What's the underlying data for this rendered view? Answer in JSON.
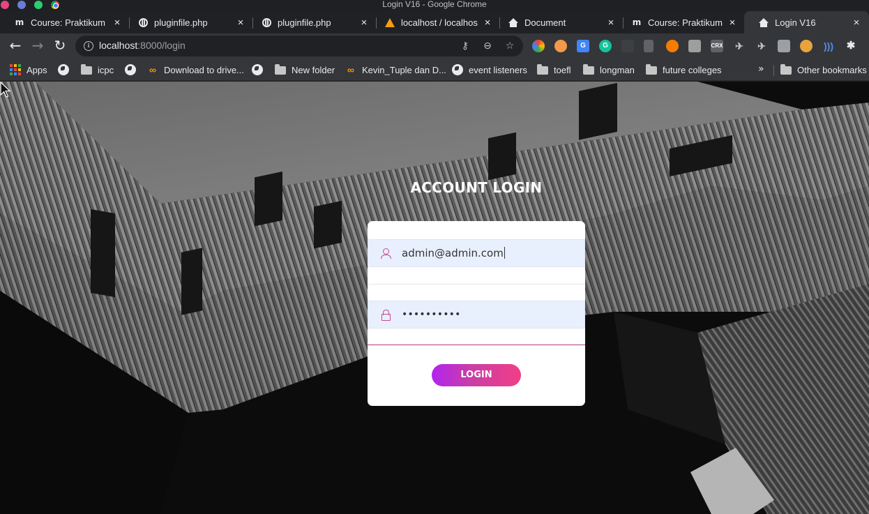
{
  "window": {
    "title": "Login V16 - Google Chrome"
  },
  "tabs": [
    {
      "label": "Course: Praktikum P",
      "icon": "moodle-icon"
    },
    {
      "label": "pluginfile.php",
      "icon": "globe-icon"
    },
    {
      "label": "pluginfile.php",
      "icon": "globe-icon"
    },
    {
      "label": "localhost / localhost",
      "icon": "phpmyadmin-icon"
    },
    {
      "label": "Document",
      "icon": "home-icon"
    },
    {
      "label": "Course: Praktikum P",
      "icon": "moodle-icon"
    },
    {
      "label": "Login V16",
      "icon": "home-icon",
      "active": true
    }
  ],
  "toolbar": {
    "url_host": "localhost",
    "url_rest": ":8000/login"
  },
  "bookmarks": {
    "items": [
      {
        "label": "Apps",
        "icon": "apps-grid-icon"
      },
      {
        "label": "",
        "icon": "globe-icon"
      },
      {
        "label": "icpc",
        "icon": "folder-icon"
      },
      {
        "label": "",
        "icon": "globe-icon"
      },
      {
        "label": "Download to drive...",
        "icon": "infinity-icon"
      },
      {
        "label": "",
        "icon": "globe-icon"
      },
      {
        "label": "New folder",
        "icon": "folder-icon"
      },
      {
        "label": "Kevin_Tuple dan D...",
        "icon": "infinity-icon"
      },
      {
        "label": "event listeners",
        "icon": "globe-icon"
      },
      {
        "label": "toefl",
        "icon": "folder-icon"
      },
      {
        "label": "longman",
        "icon": "folder-icon"
      },
      {
        "label": "future colleges",
        "icon": "folder-icon"
      }
    ],
    "overflow": "»",
    "other": "Other bookmarks"
  },
  "login": {
    "title": "ACCOUNT LOGIN",
    "username_value": "admin@admin.com",
    "password_value": "••••••••••",
    "button_label": "LOGIN"
  },
  "colors": {
    "accent_start": "#b224ef",
    "accent_end": "#f23e87",
    "field_bg": "#e8f0fe",
    "icon_pink": "#c44a8f"
  }
}
